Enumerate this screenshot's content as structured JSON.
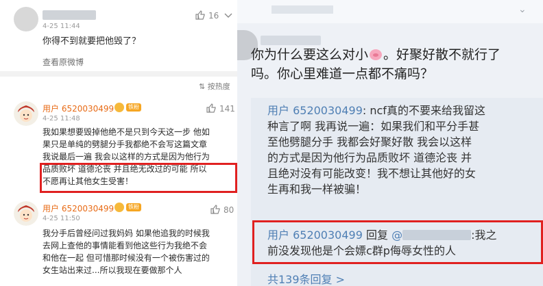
{
  "left": {
    "comment1": {
      "like_count": "16",
      "time": "4-25 11:44",
      "text": "你得不到就要把他毁了？",
      "view_original": "查看原微博"
    },
    "sort_label": "按热度",
    "comment2": {
      "username": "用户 6520030499",
      "fan_badge": "铁粉",
      "like_count": "141",
      "time": "4-25 11:48",
      "lines": [
        "我如果想要毁掉他绝不是只到今天这一步 他如",
        "果只是单纯的劈腿分手我都绝不会写这篇文章",
        "我说最后一遍 我会以这样的方式是因为他行为",
        "品质败坏 道德沦丧 并且绝无改过的可能 所以",
        "不愿再让其他女生受害！"
      ]
    },
    "comment3": {
      "username": "用户 6520030499",
      "fan_badge": "铁粉",
      "like_count": "80",
      "time": "4-25 11:50",
      "lines": [
        "我分手后曾经问过我妈妈 如果他追我的时候我",
        "去网上查他的事情能看到他这些行为我绝不会",
        "和他在一起 但可惜那时候没有一个被伤害过的",
        "女生站出来过...所以我现在要做那个人"
      ]
    }
  },
  "right": {
    "main_lines": [
      "你为什么要这么对小",
      "。好聚好散不就行了",
      "吗。你心里难道一点都不痛吗？"
    ],
    "reply1": {
      "user": "用户 6520030499",
      "lines": [
        ": ncf真的不要来给我留这",
        "种言了啊 我再说一遍：如果我们和平分手甚",
        "至他劈腿分手 我都会好聚好散 我会以这样",
        "的方式是因为他行为品质败坏 道德沦丧 并",
        "且绝对没有可能改变！我不想让其他好的女",
        "生再和我一样被骗！"
      ]
    },
    "reply2": {
      "user": "用户 6520030499",
      "reply_word": " 回复 ",
      "mention": "@",
      "line1_tail": ":我之",
      "line2": "前没发现他是个会嫖c群p侮辱女性的人"
    },
    "more_replies": "共139条回复 >"
  },
  "colors": {
    "highlight": "#e02020",
    "username": "#e86b16",
    "link_blue": "#4f7fb4"
  }
}
